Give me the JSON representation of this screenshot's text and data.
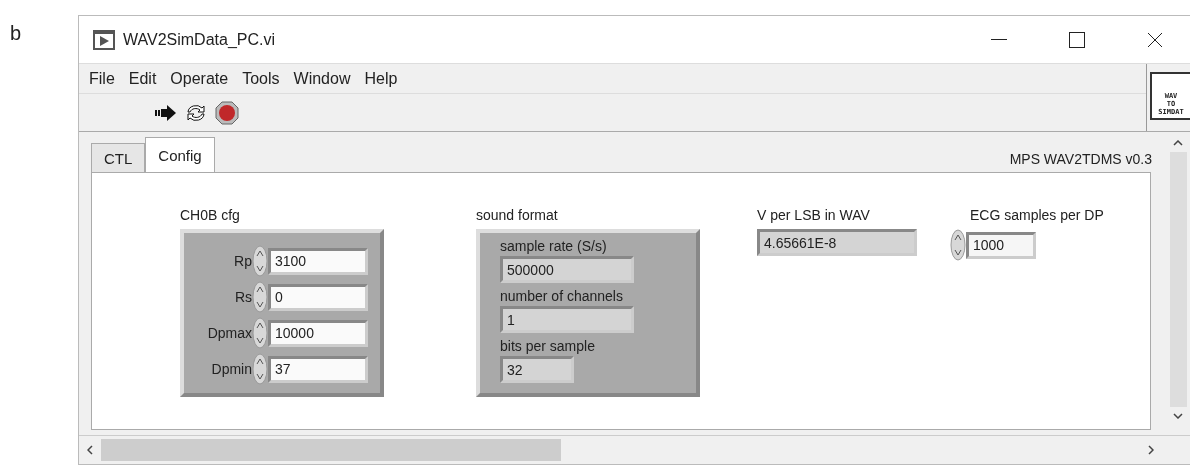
{
  "panel_label": "b",
  "window": {
    "title": "WAV2SimData_PC.vi"
  },
  "menu": [
    "File",
    "Edit",
    "Operate",
    "Tools",
    "Window",
    "Help"
  ],
  "connector_icon": {
    "lines": [
      "WAV",
      "TO",
      "SIMDAT"
    ]
  },
  "tabs": [
    {
      "label": "CTL",
      "selected": false
    },
    {
      "label": "Config",
      "selected": true
    }
  ],
  "version": "MPS WAV2TDMS v0.3",
  "ch0b": {
    "title": "CH0B cfg",
    "controls": [
      {
        "label": "Rp",
        "value": "3100"
      },
      {
        "label": "Rs",
        "value": "0"
      },
      {
        "label": "Dpmax",
        "value": "10000"
      },
      {
        "label": "Dpmin",
        "value": "37"
      }
    ]
  },
  "sound_format": {
    "title": "sound format",
    "indicators": [
      {
        "label": "sample rate (S/s)",
        "value": "500000",
        "kind": "wide"
      },
      {
        "label": "number of channels",
        "value": "1",
        "kind": "wide"
      },
      {
        "label": "bits per sample",
        "value": "32",
        "kind": "narrow"
      }
    ]
  },
  "v_per_lsb": {
    "label": "V per LSB in WAV",
    "value": "4.65661E-8"
  },
  "ecg": {
    "label": "ECG samples per DP",
    "value": "1000"
  }
}
